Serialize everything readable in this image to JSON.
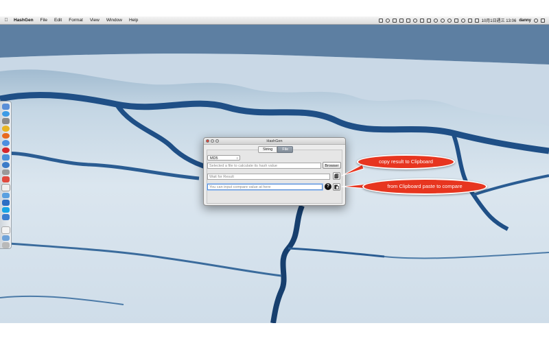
{
  "menubar": {
    "app_name": "HashGen",
    "items": [
      "File",
      "Edit",
      "Format",
      "View",
      "Window",
      "Help"
    ],
    "clock": "10月1日週三  13:06",
    "user": "danny"
  },
  "window": {
    "title": "HashGen",
    "tabs": [
      {
        "label": "String",
        "active": false
      },
      {
        "label": "File",
        "active": true
      }
    ],
    "algorithm_select": "MD5",
    "file_field_placeholder": "Selected a file to calculate its hash value",
    "browser_button": "Browser",
    "result_field": "Wait for Result",
    "compare_field_placeholder": "You can input compare value at here",
    "help_button": "?"
  },
  "callouts": {
    "copy": "copy result to Clipboard",
    "paste": "from Clipboard paste to compare"
  },
  "colors": {
    "callout": "#e7351f",
    "close_button": "#e0443a",
    "active_tab": "#8a95a1"
  }
}
